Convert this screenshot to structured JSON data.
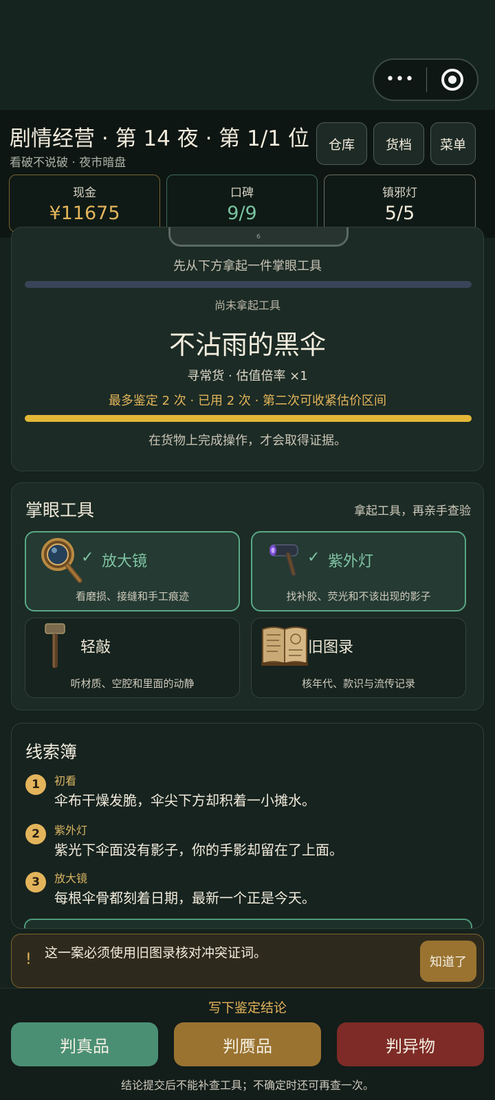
{
  "capsule": {
    "more_label": "•••"
  },
  "header": {
    "title": "剧情经营 · 第 14 夜 · 第 1/1 位",
    "subtitle": "看破不说破 · 夜市暗盘",
    "buttons": {
      "warehouse": "仓库",
      "ledger": "货档",
      "menu": "菜单"
    }
  },
  "stats": {
    "cash": {
      "label": "现金",
      "value": "¥11675",
      "color": "#e3b45b"
    },
    "reputation": {
      "label": "口碑",
      "value": "9/9",
      "color": "#79c3a0"
    },
    "lamp": {
      "label": "镇邪灯",
      "value": "5/5",
      "color": "#f1ebdc"
    }
  },
  "appraisal": {
    "tab_hint": "6",
    "prompt": "先从下方拿起一件掌眼工具",
    "tool_state": "尚未拿起工具",
    "item_name": "不沾雨的黑伞",
    "item_meta": "寻常货 · 估值倍率 ×1",
    "usage": "最多鉴定 2 次 · 已用 2 次 · 第二次可收紧估价区间",
    "usage_progress": 1.0,
    "note": "在货物上完成操作，才会取得证据。"
  },
  "tools": {
    "title": "掌眼工具",
    "hint": "拿起工具，再亲手查验",
    "items": [
      {
        "name": "放大镜",
        "desc": "看磨损、接缝和手工痕迹",
        "used": true,
        "icon": "magnifier-icon"
      },
      {
        "name": "紫外灯",
        "desc": "找补胶、荧光和不该出现的影子",
        "used": true,
        "icon": "uv-lamp-icon"
      },
      {
        "name": "轻敲",
        "desc": "听材质、空腔和里面的动静",
        "used": false,
        "icon": "hammer-icon"
      },
      {
        "name": "旧图录",
        "desc": "核年代、款识与流传记录",
        "used": false,
        "icon": "old-catalog-icon"
      }
    ],
    "check_glyph": "✓"
  },
  "clues": {
    "title": "线索簿",
    "items": [
      {
        "num": "1",
        "source": "初看",
        "text": "伞布干燥发脆，伞尖下方却积着一小摊水。"
      },
      {
        "num": "2",
        "source": "紫外灯",
        "text": "紫光下伞面没有影子，你的手影却留在了上面。"
      },
      {
        "num": "3",
        "source": "放大镜",
        "text": "每根伞骨都刻着日期，最新一个正是今天。"
      }
    ]
  },
  "toast": {
    "icon": "!",
    "message": "这一案必须使用旧图录核对冲突证词。",
    "dismiss": "知道了"
  },
  "verdict": {
    "heading": "写下鉴定结论",
    "genuine": "判真品",
    "fake": "判赝品",
    "anomaly": "判异物",
    "footnote": "结论提交后不能补查工具；不确定时还可再查一次。",
    "colors": {
      "genuine": "#4a8f74",
      "fake": "#9a7331",
      "anomaly": "#7e2b27"
    }
  }
}
